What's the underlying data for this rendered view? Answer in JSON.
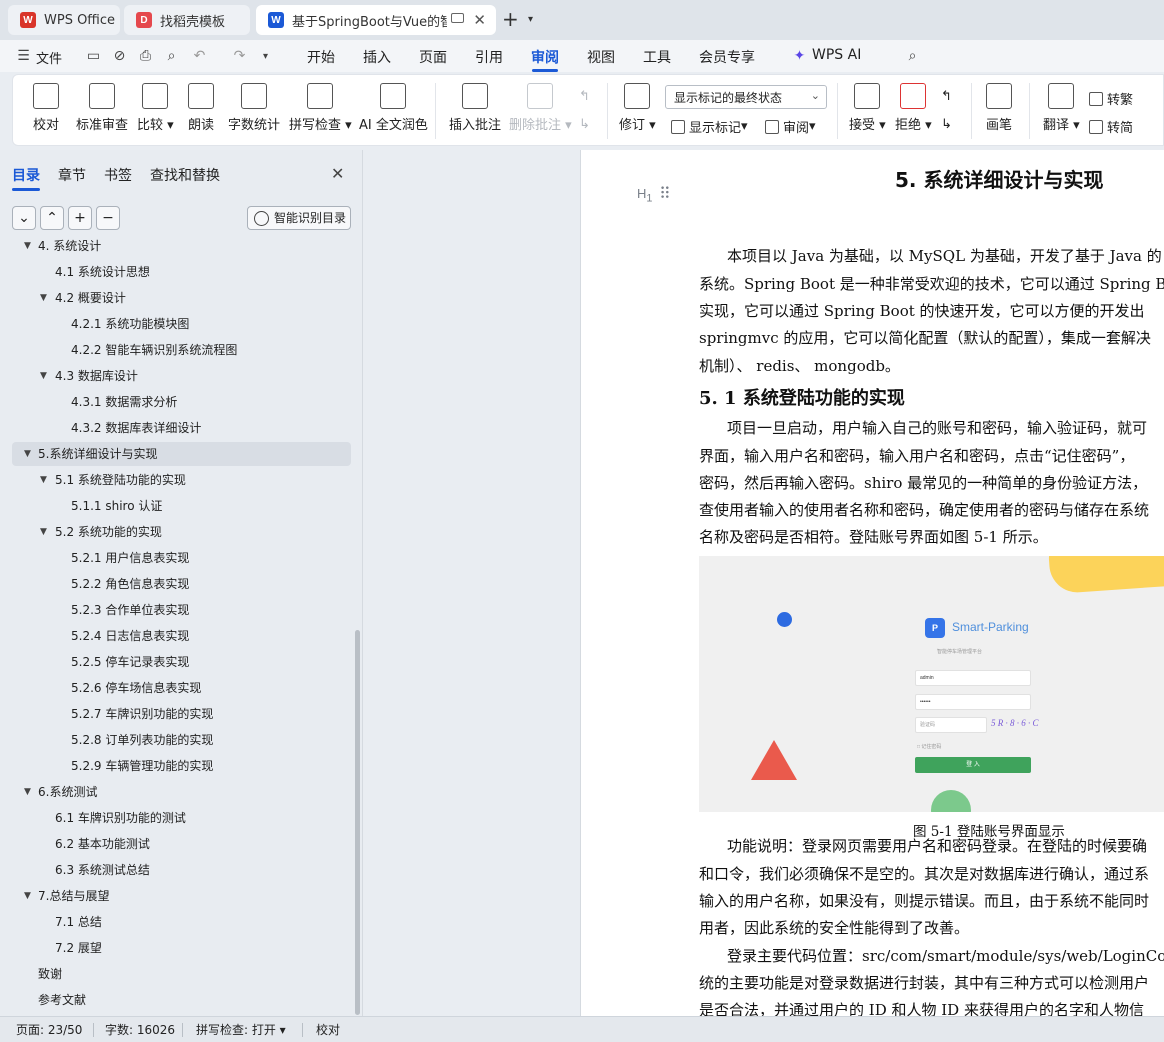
{
  "tabs": [
    {
      "label": "WPS Office",
      "icon": "wps-logo-icon",
      "color": "#d9352a"
    },
    {
      "label": "找稻壳模板",
      "icon": "docer-icon",
      "color": "#e5484d"
    },
    {
      "label": "基于SpringBoot与Vue的智能",
      "icon": "writer-icon",
      "color": "#1b59d6"
    }
  ],
  "menubar": {
    "file": "文件",
    "items": [
      "开始",
      "插入",
      "页面",
      "引用",
      "审阅",
      "视图",
      "工具",
      "会员专享"
    ],
    "active": "审阅",
    "ai": "WPS AI"
  },
  "ribbon": {
    "buttons": [
      "校对",
      "标准审查",
      "比较",
      "朗读",
      "字数统计",
      "拼写检查",
      "AI 全文润色",
      "插入批注",
      "删除批注",
      "修订",
      "画笔"
    ],
    "markup_select": "显示标记的最终状态",
    "small": [
      "显示标记",
      "审阅",
      "接受",
      "拒绝",
      "翻译",
      "转繁",
      "转简"
    ]
  },
  "nav": {
    "tabs": [
      "目录",
      "章节",
      "书签",
      "查找和替换"
    ],
    "smart_button": "智能识别目录",
    "toc": [
      {
        "label": "4. 系统设计",
        "level": 1
      },
      {
        "label": "4.1  系统设计思想",
        "level": 2
      },
      {
        "label": "4.2  概要设计",
        "level": 2
      },
      {
        "label": "4.2.1  系统功能模块图",
        "level": 3
      },
      {
        "label": "4.2.2  智能车辆识别系统流程图",
        "level": 3
      },
      {
        "label": "4.3  数据库设计",
        "level": 2
      },
      {
        "label": "4.3.1  数据需求分析",
        "level": 3
      },
      {
        "label": "4.3.2  数据库表详细设计",
        "level": 3
      },
      {
        "label": "5.系统详细设计与实现",
        "level": 1
      },
      {
        "label": "5.1  系统登陆功能的实现",
        "level": 2
      },
      {
        "label": "5.1.1 shiro 认证",
        "level": 3
      },
      {
        "label": "5.2  系统功能的实现",
        "level": 2
      },
      {
        "label": "5.2.1  用户信息表实现",
        "level": 3
      },
      {
        "label": "5.2.2  角色信息表实现",
        "level": 3
      },
      {
        "label": "5.2.3  合作单位表实现",
        "level": 3
      },
      {
        "label": "5.2.4  日志信息表实现",
        "level": 3
      },
      {
        "label": "5.2.5  停车记录表实现",
        "level": 3
      },
      {
        "label": "5.2.6  停车场信息表实现",
        "level": 3
      },
      {
        "label": "5.2.7  车牌识别功能的实现",
        "level": 3
      },
      {
        "label": "5.2.8  订单列表功能的实现",
        "level": 3
      },
      {
        "label": "5.2.9  车辆管理功能的实现",
        "level": 3
      },
      {
        "label": "6.系统测试",
        "level": 1
      },
      {
        "label": "6.1  车牌识别功能的测试",
        "level": 2
      },
      {
        "label": "6.2  基本功能测试",
        "level": 2
      },
      {
        "label": "6.3  系统测试总结",
        "level": 2
      },
      {
        "label": "7.总结与展望",
        "level": 1
      },
      {
        "label": "7.1  总结",
        "level": 2
      },
      {
        "label": "7.2  展望",
        "level": 2
      },
      {
        "label": "致谢",
        "level": 1
      },
      {
        "label": "参考文献",
        "level": 1
      }
    ]
  },
  "document": {
    "heading": "5. 系统详细设计与实现",
    "para1": [
      "本项目以 Java 为基础，以 MySQL 为基础，开发了基于 Java 的",
      "系统。Spring Boot 是一种非常受欢迎的技术，它可以通过 Spring B",
      "实现，它可以通过 Spring Boot 的快速开发，它可以方便的开发出",
      "springmvc 的应用，它可以简化配置（默认的配置），集成一套解决",
      "机制）、 redis、 mongodb。"
    ],
    "subheading": "5. 1  系统登陆功能的实现",
    "para2": [
      "项目一旦启动，用户输入自己的账号和密码，输入验证码，就可",
      "界面，输入用户名和密码，输入用户名和密码，点击“记住密码”，",
      "密码，然后再输入密码。shiro 最常见的一种简单的身份验证方法，",
      "查使用者输入的使用者名称和密码，确定使用者的密码与储存在系统",
      "名称及密码是否相符。登陆账号界面如图 5-1 所示。"
    ],
    "figure": {
      "app_name": "Smart-Parking",
      "subtitle": "智能停车场管理平台",
      "username": "admin",
      "password": "••••••",
      "captcha_placeholder": "验证码",
      "captcha": "5 R · 8 · 6 · C",
      "remember": "记住密码",
      "login": "登 入"
    },
    "caption": "图 5-1  登陆账号界面显示",
    "para3": [
      "功能说明：登录网页需要用户名和密码登录。在登陆的时候要确",
      "和口令，我们必须确保不是空的。其次是对数据库进行确认，通过系",
      "输入的用户名称，如果没有，则提示错误。而且，由于系统不能同时",
      "用者，因此系统的安全性能得到了改善。"
    ],
    "para4": [
      "登录主要代码位置：src/com/smart/module/sys/web/LoginControll",
      "统的主要功能是对登录数据进行封装，其中有三种方式可以检测用户",
      "是否合法，并通过用户的 ID 和人物 ID 来获得用户的名字和人物信"
    ]
  },
  "status": {
    "page": "页面: 23/50",
    "words": "字数: 16026",
    "spell": "拼写检查: 打开",
    "proof": "校对"
  }
}
